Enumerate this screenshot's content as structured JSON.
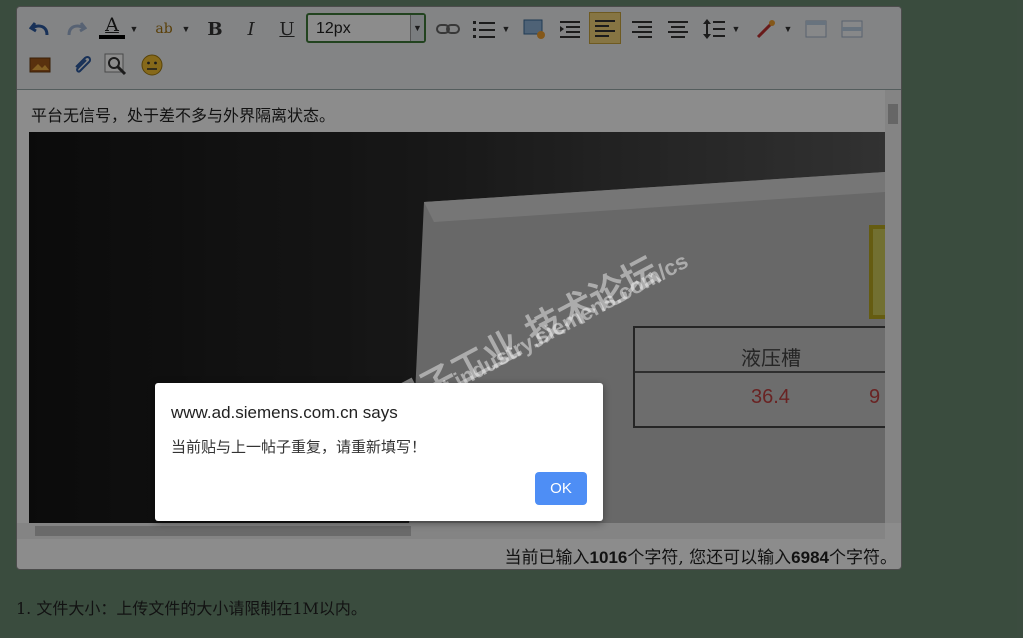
{
  "toolbar": {
    "font_size_value": "12px",
    "items": [
      "undo",
      "redo",
      "font-color",
      "highlight",
      "bold",
      "italic",
      "underline",
      "link",
      "list",
      "insert-image",
      "indent",
      "align-left",
      "align-right",
      "align-center",
      "line-height",
      "format-painter",
      "table",
      "table-split",
      "image",
      "attachment",
      "search",
      "emoji"
    ],
    "labels": {
      "bold": "B",
      "italic": "I",
      "underline": "U",
      "font_color": "A",
      "highlight": "ab"
    }
  },
  "content": {
    "first_line": "平台无信号，处于差不多与外界隔离状态。",
    "photo_label_header": "液压槽",
    "photo_value_1": "36.4",
    "photo_value_2": "9"
  },
  "watermark": {
    "line1": "西门子工业 技术论坛",
    "line2": "support.industry.siemens.com/cs"
  },
  "counter": {
    "prefix": "当前已输入",
    "typed": "1016",
    "middle": "个字符, 您还可以输入",
    "remaining": "6984",
    "suffix": "个字符。"
  },
  "note": "1. 文件大小：上传文件的大小请限制在1M以内。",
  "dialog": {
    "title": "www.ad.siemens.com.cn says",
    "message": "当前贴与上一帖子重复，请重新填写！",
    "ok_label": "OK"
  },
  "colors": {
    "accent": "#4e8ef5",
    "font_select_border": "#3f7a3a",
    "overlay": "rgba(0,0,0,0.45)"
  }
}
